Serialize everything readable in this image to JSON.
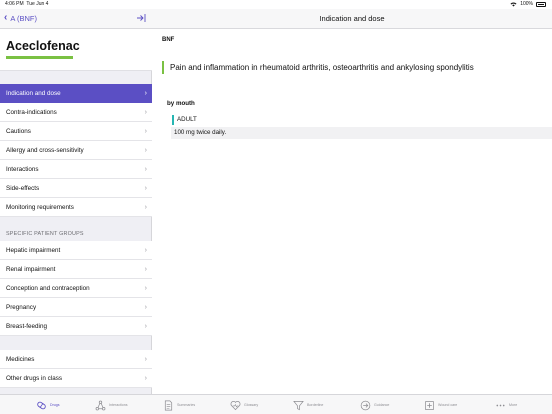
{
  "status_bar": {
    "time": "4:06 PM",
    "date": "Tue Jun 4",
    "battery": "100%"
  },
  "sidebar": {
    "back_label": "A (BNF)",
    "drug_title": "Aceclofenac",
    "main_items": [
      {
        "label": "Indication and dose",
        "active": true
      },
      {
        "label": "Contra-indications"
      },
      {
        "label": "Cautions"
      },
      {
        "label": "Allergy and cross-sensitivity"
      },
      {
        "label": "Interactions"
      },
      {
        "label": "Side-effects"
      },
      {
        "label": "Monitoring requirements"
      }
    ],
    "section_title": "SPECIFIC PATIENT GROUPS",
    "patient_items": [
      {
        "label": "Hepatic impairment"
      },
      {
        "label": "Renal impairment"
      },
      {
        "label": "Conception and contraception"
      },
      {
        "label": "Pregnancy"
      },
      {
        "label": "Breast-feeding"
      }
    ],
    "extra_items": [
      {
        "label": "Medicines"
      },
      {
        "label": "Other drugs in class"
      }
    ]
  },
  "main": {
    "header_title": "Indication and dose",
    "source_label": "BNF",
    "indication": "Pain and inflammation in rheumatoid arthritis, osteoarthritis and ankylosing spondylitis",
    "route": "by mouth",
    "patient_group": "ADULT",
    "dose": "100 mg twice daily."
  },
  "tabbar": {
    "items": [
      {
        "label": "Drugs",
        "icon": "pill-icon",
        "active": true
      },
      {
        "label": "Interactions",
        "icon": "network-icon"
      },
      {
        "label": "Summaries",
        "icon": "document-icon"
      },
      {
        "label": "Glossary",
        "icon": "heart-icon"
      },
      {
        "label": "Borderline",
        "icon": "funnel-icon"
      },
      {
        "label": "Guidance",
        "icon": "arrow-circle-icon"
      },
      {
        "label": "Wound care",
        "icon": "plus-box-icon"
      },
      {
        "label": "More",
        "icon": "more-icon"
      }
    ]
  },
  "colors": {
    "accent": "#5b4fc4",
    "indication_bar": "#7ac143",
    "patient_bar": "#26b6b3"
  }
}
